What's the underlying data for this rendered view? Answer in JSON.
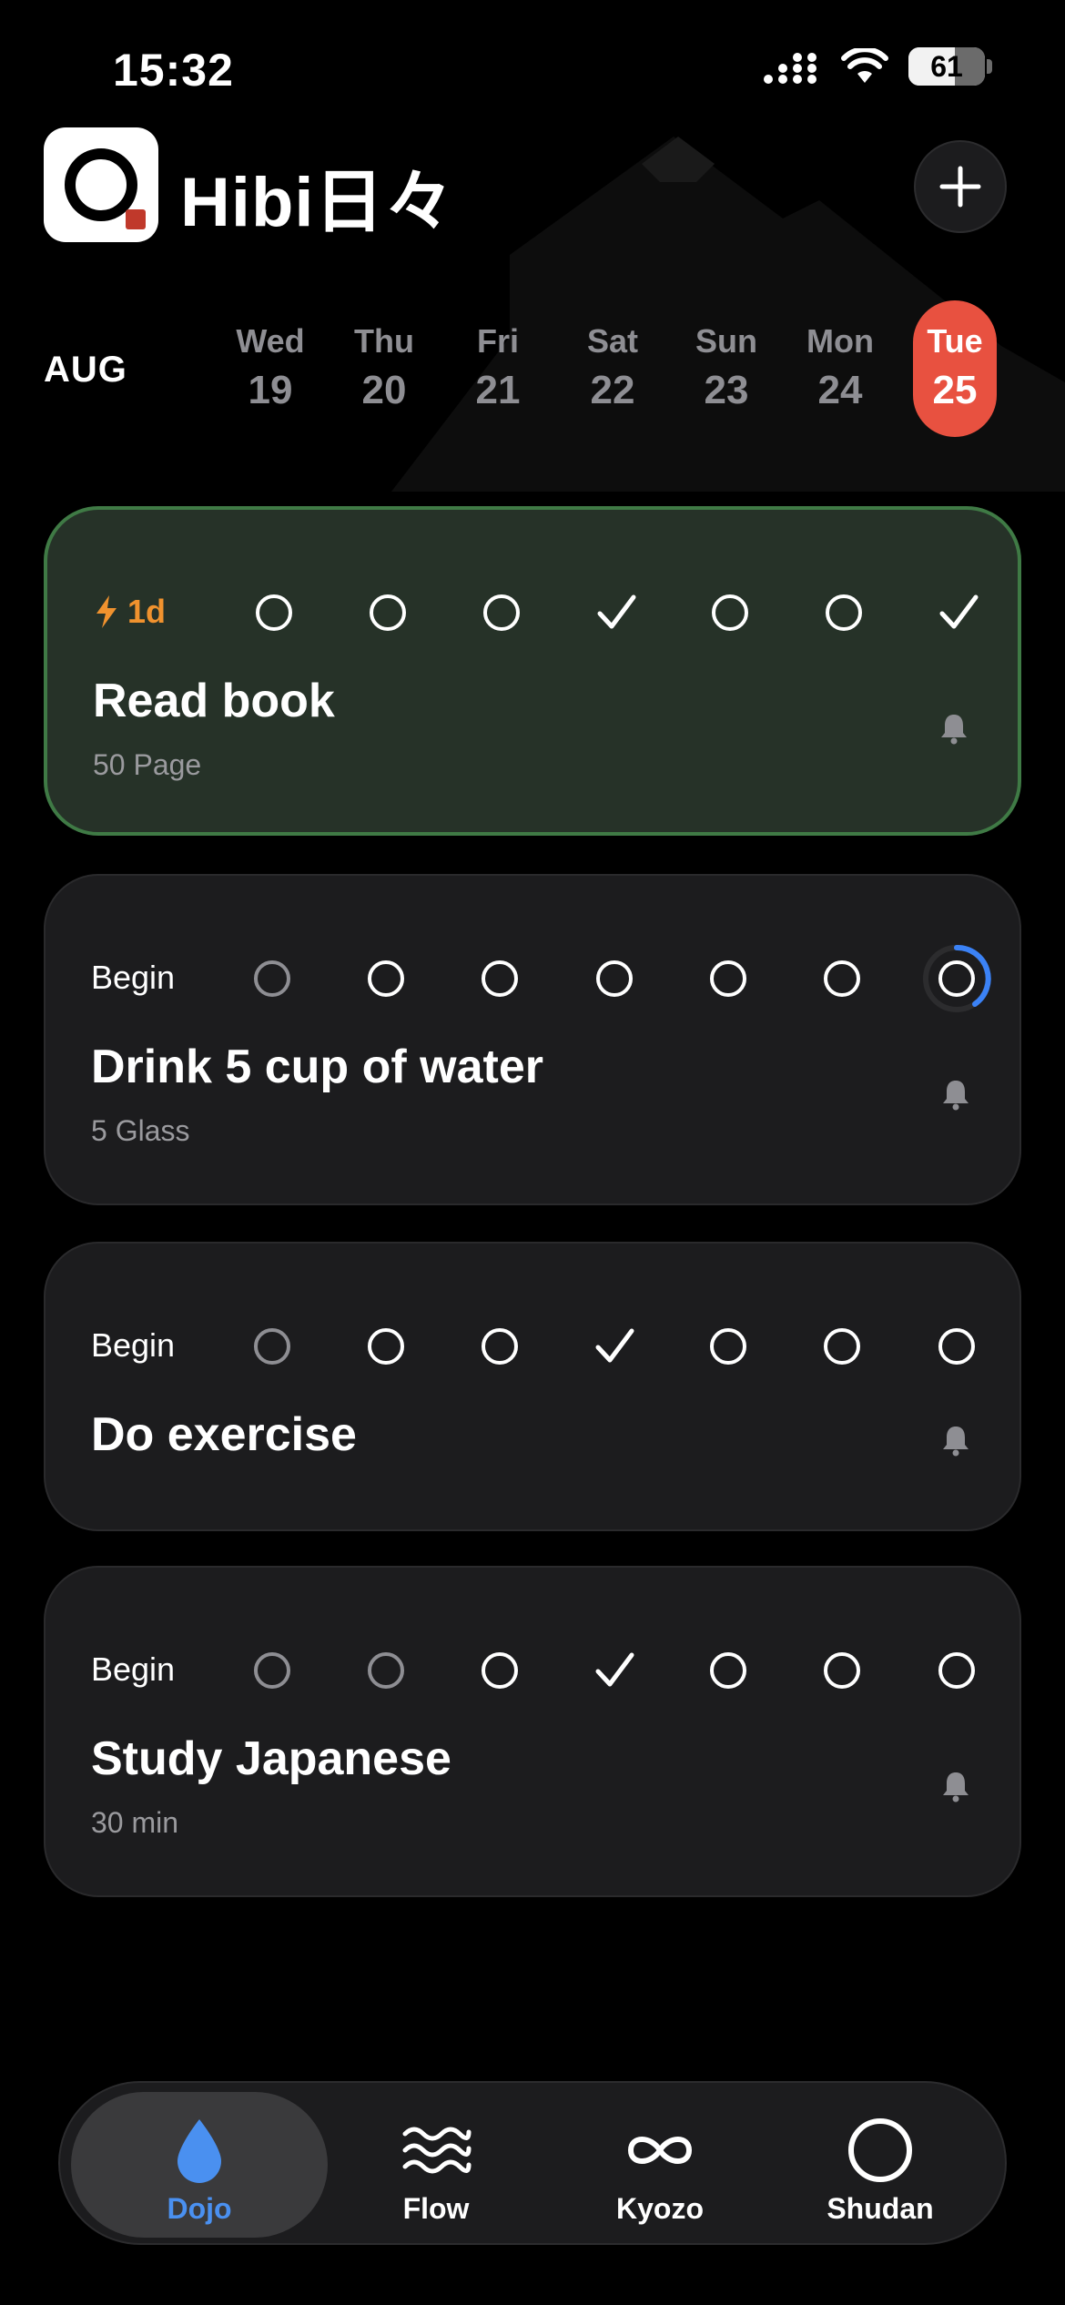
{
  "status_bar": {
    "time": "15:32",
    "battery": "61",
    "battery_level": 0.61
  },
  "header": {
    "app_name": "Hibi日々"
  },
  "calendar": {
    "month": "AUG",
    "days": [
      {
        "dow": "Wed",
        "date": "19"
      },
      {
        "dow": "Thu",
        "date": "20"
      },
      {
        "dow": "Fri",
        "date": "21"
      },
      {
        "dow": "Sat",
        "date": "22"
      },
      {
        "dow": "Sun",
        "date": "23"
      },
      {
        "dow": "Mon",
        "date": "24"
      },
      {
        "dow": "Tue",
        "date": "25",
        "today": true
      }
    ]
  },
  "habits": [
    {
      "title": "Read book",
      "subtitle": "50 Page",
      "streak": "1d",
      "marks": [
        "open",
        "open",
        "open",
        "check",
        "open",
        "open",
        "check"
      ]
    },
    {
      "title": "Drink 5 cup of water",
      "subtitle": "5 Glass",
      "streak": "Begin",
      "marks": [
        "dim",
        "open",
        "open",
        "open",
        "open",
        "open",
        "progress"
      ]
    },
    {
      "title": "Do exercise",
      "subtitle": "",
      "streak": "Begin",
      "marks": [
        "dim",
        "open",
        "open",
        "check",
        "open",
        "open",
        "open"
      ]
    },
    {
      "title": "Study Japanese",
      "subtitle": "30 min",
      "streak": "Begin",
      "marks": [
        "dim",
        "dim",
        "open",
        "check",
        "open",
        "open",
        "open"
      ]
    }
  ],
  "tabs": [
    {
      "label": "Dojo",
      "icon": "drop-icon",
      "selected": true
    },
    {
      "label": "Flow",
      "icon": "waves-icon"
    },
    {
      "label": "Kyozo",
      "icon": "infinity-icon"
    },
    {
      "label": "Shudan",
      "icon": "circle-icon"
    }
  ],
  "colors": {
    "today": "#e85140",
    "active_card_border": "#3f7a45",
    "streak": "#f0922e",
    "tab_selected": "#4a90f0"
  }
}
